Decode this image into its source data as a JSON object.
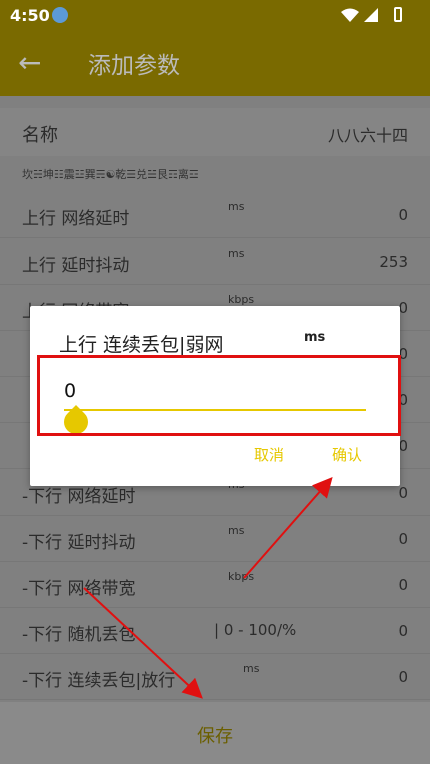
{
  "status": {
    "time": "4:50"
  },
  "appbar": {
    "title": "添加参数"
  },
  "name_row": {
    "label": "名称",
    "value": "八八六十四"
  },
  "trigram_text": "坎☵坤☷震☳巽☴☯乾☰兑☱艮☶离☲",
  "rows": [
    {
      "label": "上行 网络延时",
      "unit": "ms",
      "value": "0"
    },
    {
      "label": "上行 延时抖动",
      "unit": "ms",
      "value": "253"
    },
    {
      "label": "上行 网络带宽",
      "unit": "kbps",
      "value": "0"
    },
    {
      "label": "",
      "unit": "",
      "value": "0"
    },
    {
      "label": "",
      "unit": "",
      "value": "0"
    },
    {
      "label": "",
      "unit": "",
      "value": "0"
    },
    {
      "label": "-下行 网络延时",
      "unit": "ms",
      "value": "0"
    },
    {
      "label": "-下行 延时抖动",
      "unit": "ms",
      "value": "0"
    },
    {
      "label": "-下行 网络带宽",
      "unit": "kbps",
      "value": "0"
    },
    {
      "label": "-下行 随机丢包",
      "unit": "| 0 - 100/%",
      "value": "0"
    },
    {
      "label": "-下行 连续丢包|放行",
      "unit": "ms",
      "value": "0"
    }
  ],
  "save": {
    "label": "保存"
  },
  "dialog": {
    "title": "上行 连续丢包|弱网",
    "unit": "ms",
    "input_value": "0",
    "cancel": "取消",
    "confirm": "确认"
  },
  "colors": {
    "accent": "#e6c800",
    "appbar": "#7a6a00",
    "highlight": "#e01010"
  },
  "icons": {
    "back": "arrow-left-icon",
    "download": "download-icon",
    "wifi": "wifi-icon",
    "signal": "signal-icon",
    "battery": "battery-icon"
  }
}
